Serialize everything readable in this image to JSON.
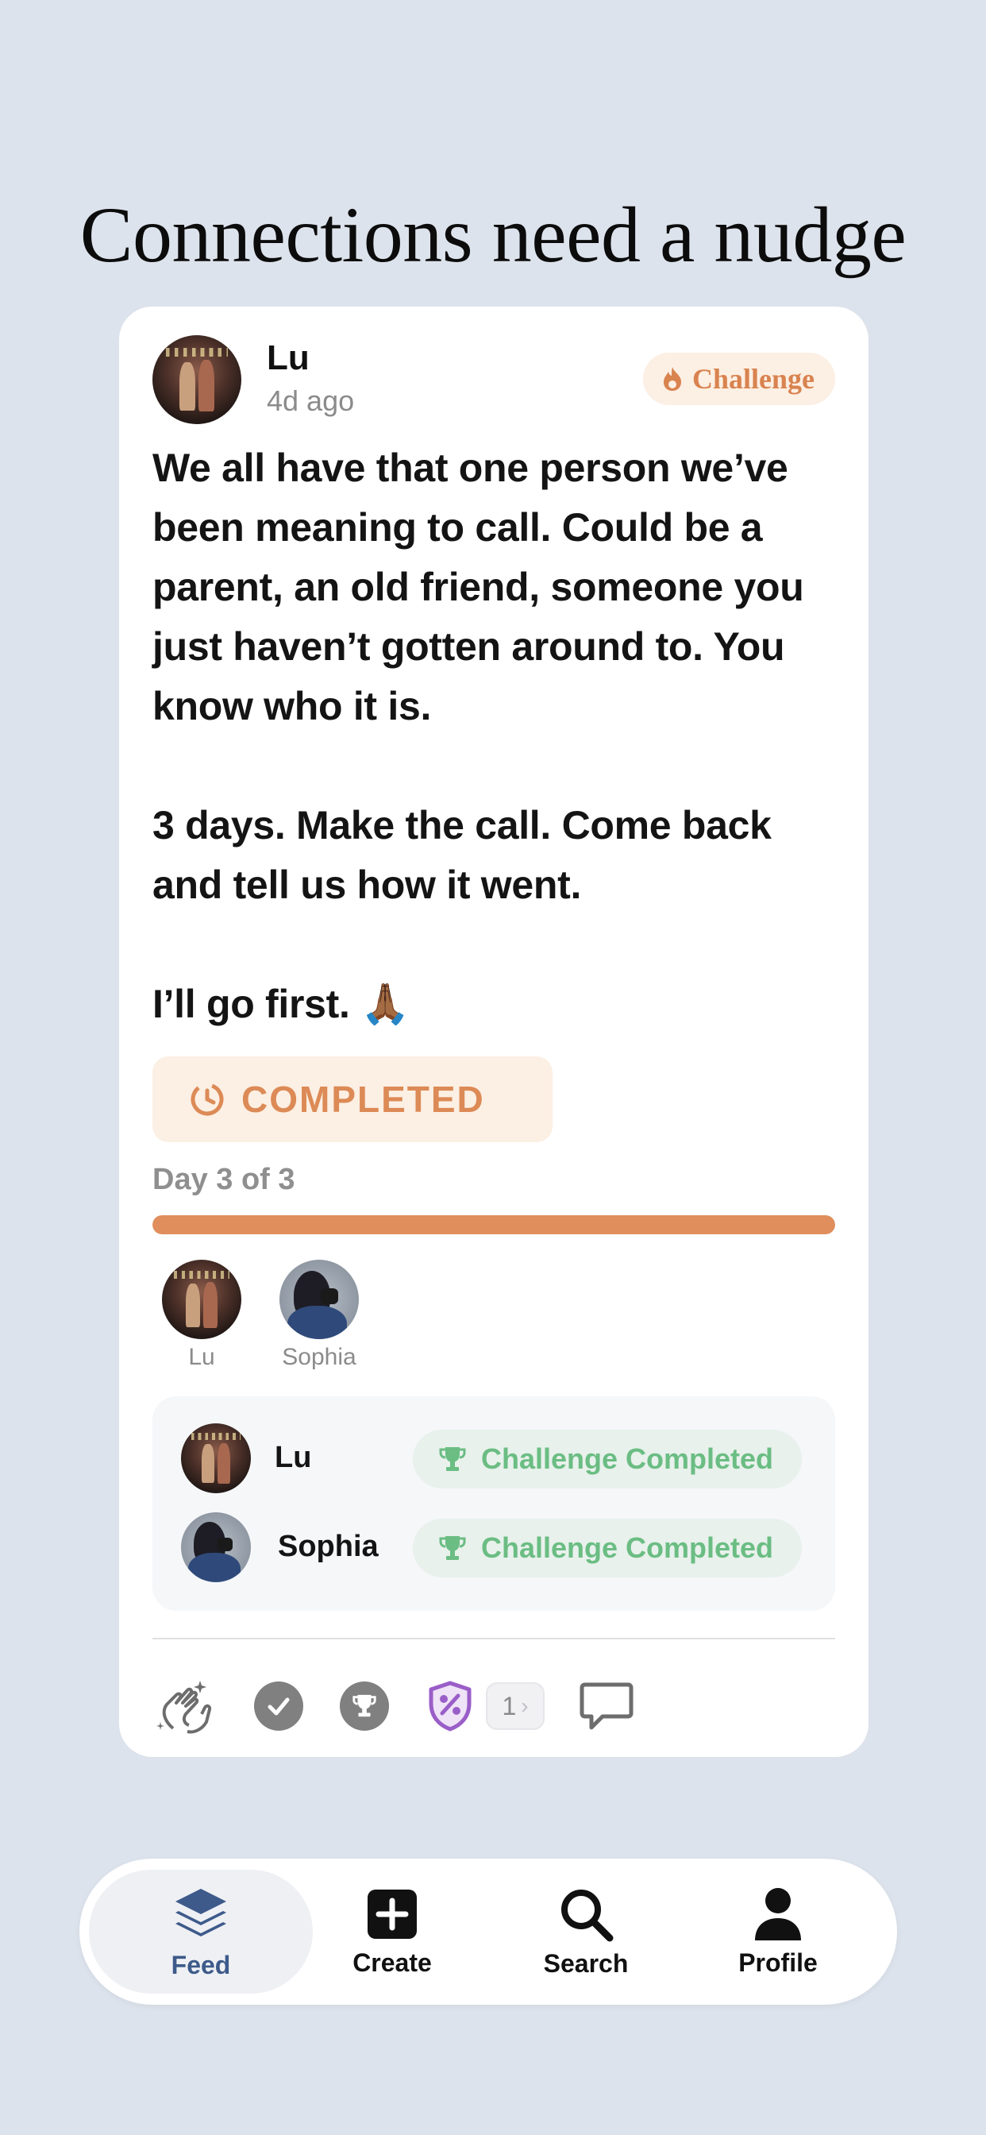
{
  "headline": "Connections need a nudge",
  "post": {
    "author": "Lu",
    "time": "4d ago",
    "badge": "Challenge",
    "body": "We all have that one person we’ve been meaning to call. Could be a parent, an old friend, someone you just haven’t gotten around to. You know who it is.\n\n3 days. Make the call. Come back and tell us how it went.\n\nI’ll go first. 🙏🏾",
    "status": "COMPLETED",
    "day_label": "Day 3 of 3",
    "progress": 1.0,
    "participants": [
      {
        "name": "Lu"
      },
      {
        "name": "Sophia"
      }
    ],
    "completions": [
      {
        "name": "Lu",
        "status": "Challenge Completed"
      },
      {
        "name": "Sophia",
        "status": "Challenge Completed"
      }
    ],
    "reactions": {
      "extra_count": "1"
    }
  },
  "tabs": [
    {
      "label": "Feed",
      "icon": "layers-icon",
      "active": true
    },
    {
      "label": "Create",
      "icon": "plus-square-icon",
      "active": false
    },
    {
      "label": "Search",
      "icon": "search-icon",
      "active": false
    },
    {
      "label": "Profile",
      "icon": "person-icon",
      "active": false
    }
  ],
  "colors": {
    "background": "#dde3ec",
    "accent_orange": "#e08e5c",
    "badge_bg": "#fcefe3",
    "success_green": "#6bbd83",
    "feed_blue": "#3d5a8a"
  }
}
